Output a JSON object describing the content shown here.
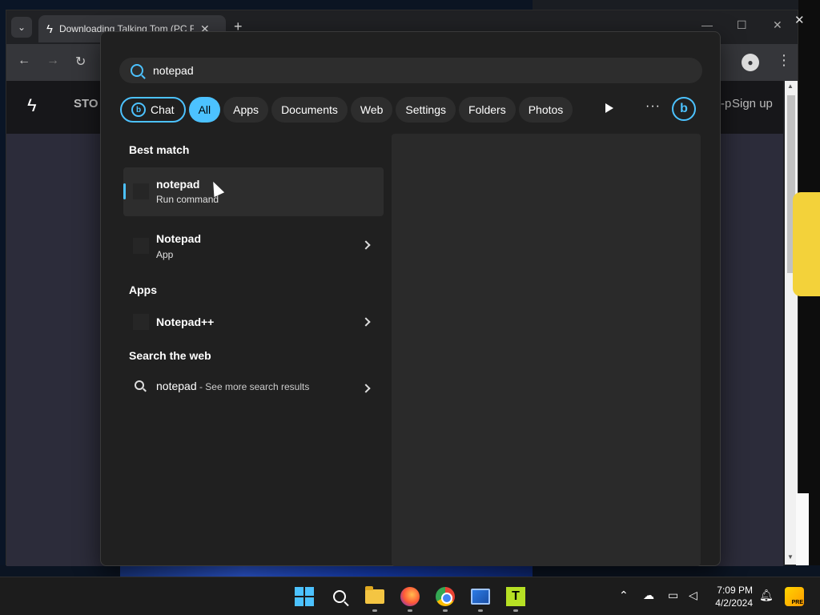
{
  "browser": {
    "tab_title": "Downloading Talking Tom (PC F",
    "site_store_label": "STO",
    "site_signup_label": "Sign up",
    "site_partial_label": "-p"
  },
  "search": {
    "query": "notepad",
    "filters": [
      {
        "label": "Chat"
      },
      {
        "label": "All"
      },
      {
        "label": "Apps"
      },
      {
        "label": "Documents"
      },
      {
        "label": "Web"
      },
      {
        "label": "Settings"
      },
      {
        "label": "Folders"
      },
      {
        "label": "Photos"
      }
    ],
    "more_label": "···",
    "bing_label": "b",
    "best_match_title": "Best match",
    "best_match": [
      {
        "title": "notepad",
        "subtitle": "Run command"
      },
      {
        "title": "Notepad",
        "subtitle": "App"
      }
    ],
    "apps_title": "Apps",
    "apps": [
      {
        "title": "Notepad++"
      }
    ],
    "web_title": "Search the web",
    "web_result": {
      "query": "notepad",
      "suffix": " - See more search results"
    }
  },
  "taskbar": {
    "time": "7:09 PM",
    "date": "4/2/2024",
    "pre_badge": "PRE"
  },
  "colors": {
    "accent": "#4cc2ff",
    "flyout_bg": "#202020"
  }
}
